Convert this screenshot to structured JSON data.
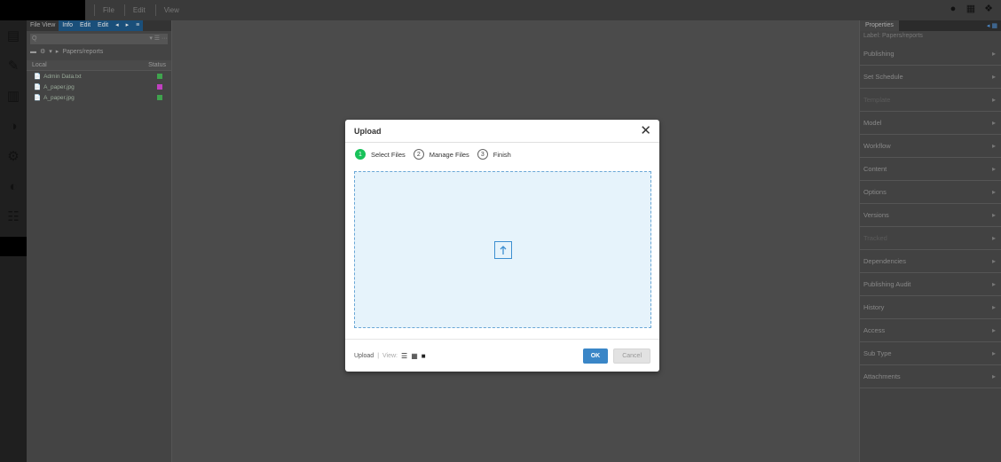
{
  "menu": [
    "File",
    "Edit",
    "View"
  ],
  "left_panel": {
    "tabs": [
      "File View",
      "Info",
      "Edit",
      "Edit",
      "◂",
      "▸",
      "≡"
    ],
    "search_value": "Q",
    "search_filter": "▾ ☰ ···",
    "path": "Papers/reports",
    "columns": {
      "left": "Local",
      "right": "Status"
    },
    "files": [
      {
        "name": "Admin Data.txt",
        "status_color": "#3fa34d"
      },
      {
        "name": "A_paper.jpg",
        "status_color": "#c040c0"
      },
      {
        "name": "A_paper.jpg",
        "status_color": "#3fa34d"
      }
    ]
  },
  "right_panel": {
    "tab": "Properties",
    "subtitle": "Label: Papers/reports",
    "items": [
      {
        "label": "Publishing",
        "dim": false
      },
      {
        "label": "Set Schedule",
        "dim": false
      },
      {
        "label": "Template",
        "dim": true
      },
      {
        "label": "Model",
        "dim": false
      },
      {
        "label": "Workflow",
        "dim": false
      },
      {
        "label": "Content",
        "dim": false
      },
      {
        "label": "Options",
        "dim": false
      },
      {
        "label": "Versions",
        "dim": false
      },
      {
        "label": "Tracked",
        "dim": true
      },
      {
        "label": "Dependencies",
        "dim": false
      },
      {
        "label": "Publishing Audit",
        "dim": false
      },
      {
        "label": "History",
        "dim": false
      },
      {
        "label": "Access",
        "dim": false
      },
      {
        "label": "Sub Type",
        "dim": false
      },
      {
        "label": "Attachments",
        "dim": false
      }
    ]
  },
  "modal": {
    "title": "Upload",
    "close": "✕",
    "steps": [
      {
        "num": "1",
        "label": "Select Files",
        "done": true
      },
      {
        "num": "2",
        "label": "Manage Files",
        "done": false
      },
      {
        "num": "3",
        "label": "Finish",
        "done": false
      }
    ],
    "footer_left": "Upload",
    "footer_sep": "|",
    "footer_view": "View:",
    "ok_label": "OK",
    "cancel_label": "Cancel"
  },
  "colors": {
    "accent": "#3a86c7",
    "step_done": "#18c25a",
    "dropzone_bg": "#e6f3fb"
  }
}
